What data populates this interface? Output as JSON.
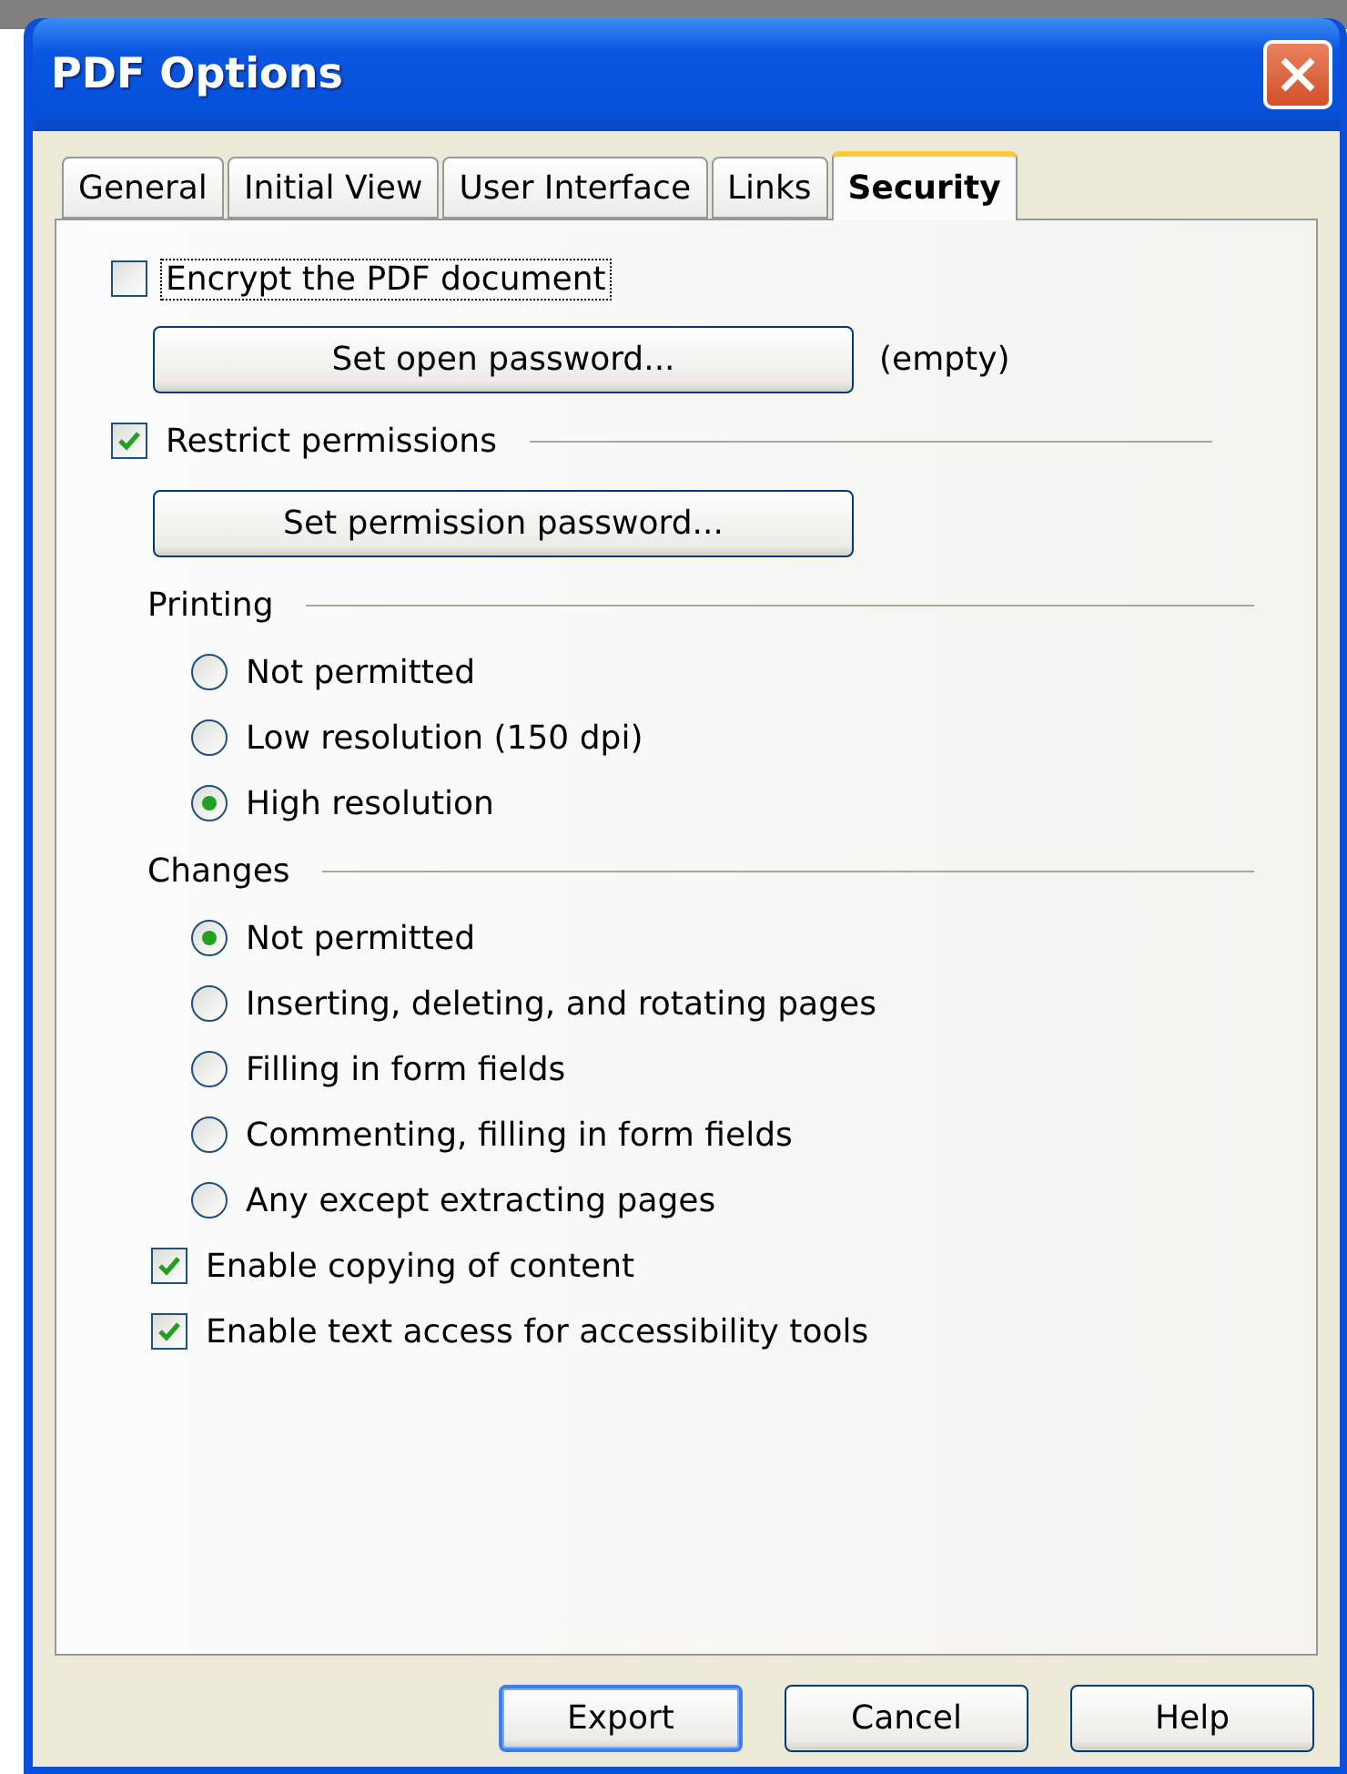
{
  "window": {
    "title": "PDF Options"
  },
  "tabs": [
    {
      "label": "General",
      "selected": false
    },
    {
      "label": "Initial View",
      "selected": false
    },
    {
      "label": "User Interface",
      "selected": false
    },
    {
      "label": "Links",
      "selected": false
    },
    {
      "label": "Security",
      "selected": true
    }
  ],
  "encrypt": {
    "label": "Encrypt the PDF document",
    "checked": false,
    "focused": true
  },
  "open_password": {
    "button": "Set open password...",
    "status": "(empty)"
  },
  "restrict": {
    "label": "Restrict permissions",
    "checked": true
  },
  "permission_password": {
    "button": "Set permission password..."
  },
  "printing": {
    "title": "Printing",
    "options": [
      {
        "label": "Not permitted",
        "selected": false
      },
      {
        "label": "Low resolution (150 dpi)",
        "selected": false
      },
      {
        "label": "High resolution",
        "selected": true
      }
    ]
  },
  "changes": {
    "title": "Changes",
    "options": [
      {
        "label": "Not permitted",
        "selected": true
      },
      {
        "label": "Inserting, deleting, and rotating pages",
        "selected": false
      },
      {
        "label": "Filling in form fields",
        "selected": false
      },
      {
        "label": "Commenting, filling in form fields",
        "selected": false
      },
      {
        "label": "Any except extracting pages",
        "selected": false
      }
    ]
  },
  "options": [
    {
      "label": "Enable copying of content",
      "checked": true
    },
    {
      "label": "Enable text access for accessibility tools",
      "checked": true
    }
  ],
  "buttons": [
    {
      "label": "Export",
      "default": true
    },
    {
      "label": "Cancel",
      "default": false
    },
    {
      "label": "Help",
      "default": false
    }
  ]
}
